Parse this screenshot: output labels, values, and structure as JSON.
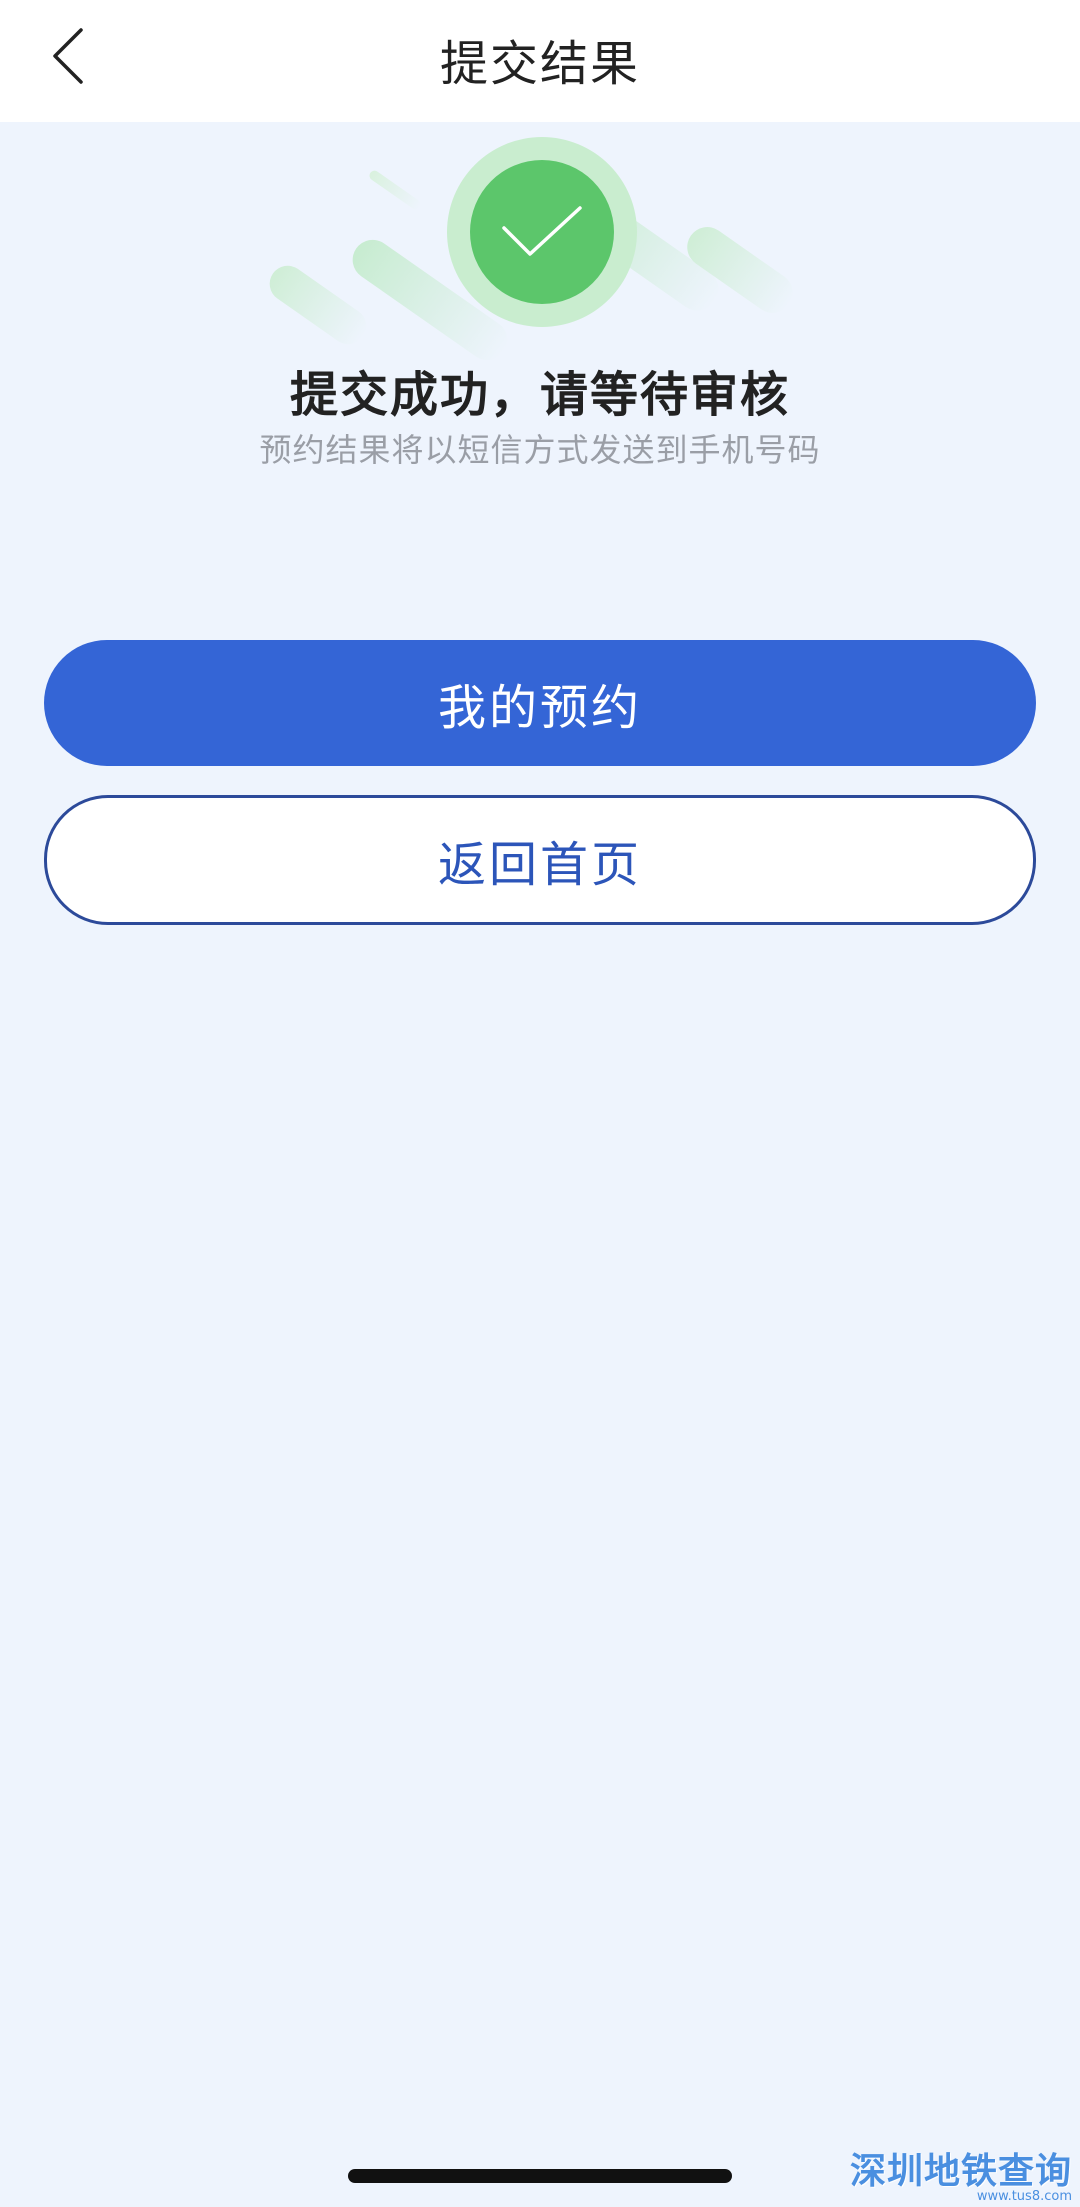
{
  "nav": {
    "title": "提交结果"
  },
  "result": {
    "title": "提交成功，请等待审核",
    "subtitle": "预约结果将以短信方式发送到手机号码"
  },
  "buttons": {
    "primary_label": "我的预约",
    "secondary_label": "返回首页"
  },
  "watermark": {
    "text": "深圳地铁查询",
    "url": "www.tus8.com"
  },
  "icons": {
    "back": "chevron-left-icon",
    "success": "checkmark-icon"
  },
  "colors": {
    "page_background": "#eef4fd",
    "primary": "#3465d6",
    "success": "#5cc66b",
    "secondary_border": "#2c4a9a"
  }
}
